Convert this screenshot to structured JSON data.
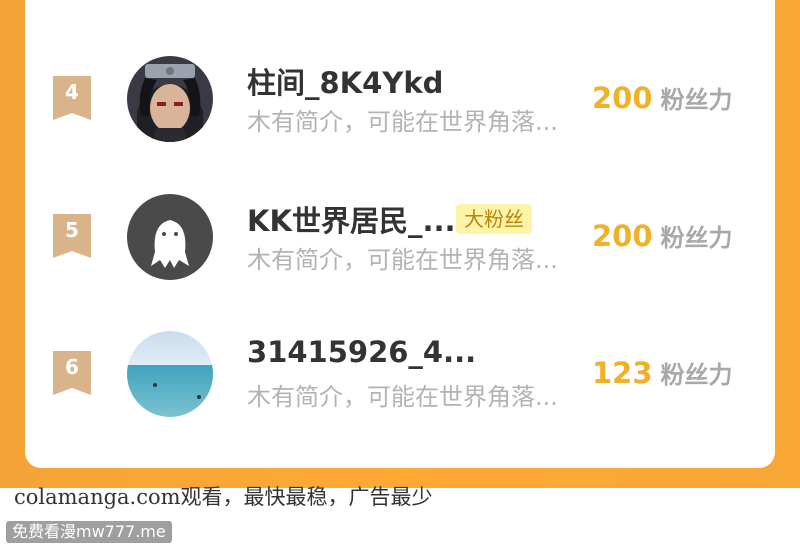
{
  "rows": [
    {
      "rank": "4",
      "name": "柱间_8K4Ykd",
      "badge": "",
      "bio": "木有简介，可能在世界角落...",
      "fans_count": "200",
      "fans_label": "粉丝力",
      "avatar": "ninja-avatar"
    },
    {
      "rank": "5",
      "name": "KK世界居民_...",
      "badge": "大粉丝",
      "bio": "木有简介，可能在世界角落...",
      "fans_count": "200",
      "fans_label": "粉丝力",
      "avatar": "default-ghost-avatar"
    },
    {
      "rank": "6",
      "name": "31415926_4...",
      "badge": "",
      "bio": "木有简介，可能在世界角落...",
      "fans_count": "123",
      "fans_label": "粉丝力",
      "avatar": "sea-avatar"
    }
  ],
  "footer": {
    "text": "colamanga.com观看，最快最稳，广告最少"
  },
  "watermark": {
    "text": "免费看漫mw777.me"
  },
  "colors": {
    "accent": "#ffa933",
    "fans": "#f0b12a",
    "rank_badge": "#d9b48a",
    "badge_bg": "#fff3a8"
  }
}
